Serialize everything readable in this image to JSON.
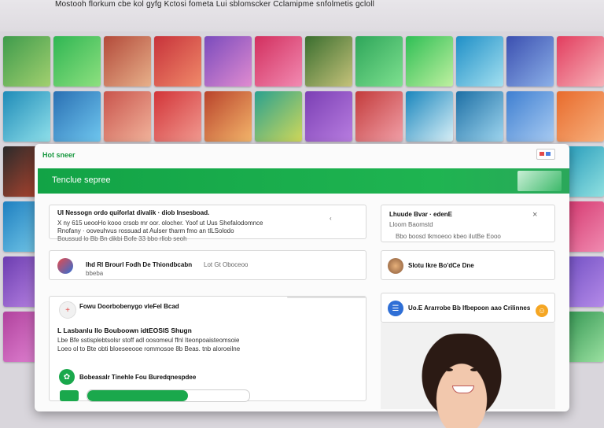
{
  "header": {
    "caption": "Mostooh florkum cbe kol gyfg Kctosi fometa Lui sblomscker Cclamipme snfolmetis gcloll"
  },
  "tiles": [
    {
      "colors": [
        "#3e9b4c",
        "#a2d06f"
      ]
    },
    {
      "colors": [
        "#2fb653",
        "#8ee07f"
      ]
    },
    {
      "colors": [
        "#b34a3a",
        "#e7b08a"
      ]
    },
    {
      "colors": [
        "#c7323a",
        "#f08a6a"
      ]
    },
    {
      "colors": [
        "#7a4bbd",
        "#e08bd0"
      ]
    },
    {
      "colors": [
        "#d22f5e",
        "#f28ab2"
      ]
    },
    {
      "colors": [
        "#3a6e2f",
        "#c5c27a"
      ]
    },
    {
      "colors": [
        "#2ea65a",
        "#7ee08f"
      ]
    },
    {
      "colors": [
        "#2fbf55",
        "#bff0a0"
      ]
    },
    {
      "colors": [
        "#1f8fc7",
        "#a3e0f0"
      ]
    },
    {
      "colors": [
        "#3b4fb0",
        "#8bb0e8"
      ]
    },
    {
      "colors": [
        "#e23d5e",
        "#f7b1b8"
      ]
    },
    {
      "colors": [
        "#1f8bb8",
        "#8fe0ea"
      ]
    },
    {
      "colors": [
        "#2a6fb3",
        "#6fc7ef"
      ]
    },
    {
      "colors": [
        "#c9544c",
        "#f1b39b"
      ]
    },
    {
      "colors": [
        "#d23438",
        "#f19a90"
      ]
    },
    {
      "colors": [
        "#b9432b",
        "#f3b56b"
      ]
    },
    {
      "colors": [
        "#2aa18f",
        "#d0d85a"
      ]
    },
    {
      "colors": [
        "#7b3fb4",
        "#b87de0"
      ]
    },
    {
      "colors": [
        "#c33b3b",
        "#f1a0a8"
      ]
    },
    {
      "colors": [
        "#1a86bd",
        "#d9f0f7"
      ]
    },
    {
      "colors": [
        "#1d6fa5",
        "#9fd6ef"
      ]
    },
    {
      "colors": [
        "#3f7fd1",
        "#a8cbf2"
      ]
    },
    {
      "colors": [
        "#e86b2c",
        "#f7b07d"
      ]
    },
    {
      "colors": [
        "#2a2a2a",
        "#c04830"
      ]
    },
    {
      "colors": [
        "#2aa05a",
        "#70d088"
      ]
    },
    {
      "colors": [
        "#d9d6dc",
        "#d9d6dc"
      ]
    },
    {
      "colors": [
        "#d9d6dc",
        "#d9d6dc"
      ]
    },
    {
      "colors": [
        "#d9d6dc",
        "#d9d6dc"
      ]
    },
    {
      "colors": [
        "#d9d6dc",
        "#d9d6dc"
      ]
    },
    {
      "colors": [
        "#d9d6dc",
        "#d9d6dc"
      ]
    },
    {
      "colors": [
        "#d9d6dc",
        "#d9d6dc"
      ]
    },
    {
      "colors": [
        "#d9d6dc",
        "#d9d6dc"
      ]
    },
    {
      "colors": [
        "#d9d6dc",
        "#d9d6dc"
      ]
    },
    {
      "colors": [
        "#d9d6dc",
        "#d9d6dc"
      ]
    },
    {
      "colors": [
        "#1f96b8",
        "#8fe0e0"
      ]
    },
    {
      "colors": [
        "#1e7fc0",
        "#7ed0ec"
      ]
    },
    {
      "colors": [
        "#2a9fa0",
        "#90e0d0"
      ]
    },
    {
      "colors": [
        "#d9d6dc",
        "#d9d6dc"
      ]
    },
    {
      "colors": [
        "#d9d6dc",
        "#d9d6dc"
      ]
    },
    {
      "colors": [
        "#d9d6dc",
        "#d9d6dc"
      ]
    },
    {
      "colors": [
        "#d9d6dc",
        "#d9d6dc"
      ]
    },
    {
      "colors": [
        "#d9d6dc",
        "#d9d6dc"
      ]
    },
    {
      "colors": [
        "#d9d6dc",
        "#d9d6dc"
      ]
    },
    {
      "colors": [
        "#d9d6dc",
        "#d9d6dc"
      ]
    },
    {
      "colors": [
        "#d9d6dc",
        "#d9d6dc"
      ]
    },
    {
      "colors": [
        "#d9d6dc",
        "#d9d6dc"
      ]
    },
    {
      "colors": [
        "#d2316a",
        "#f08ab0"
      ]
    },
    {
      "colors": [
        "#6b3db0",
        "#c08ae8"
      ]
    },
    {
      "colors": [
        "#2c86c8",
        "#9fd0f0"
      ]
    },
    {
      "colors": [
        "#d9d6dc",
        "#d9d6dc"
      ]
    },
    {
      "colors": [
        "#d9d6dc",
        "#d9d6dc"
      ]
    },
    {
      "colors": [
        "#d9d6dc",
        "#d9d6dc"
      ]
    },
    {
      "colors": [
        "#d9d6dc",
        "#d9d6dc"
      ]
    },
    {
      "colors": [
        "#d9d6dc",
        "#d9d6dc"
      ]
    },
    {
      "colors": [
        "#d9d6dc",
        "#d9d6dc"
      ]
    },
    {
      "colors": [
        "#d9d6dc",
        "#d9d6dc"
      ]
    },
    {
      "colors": [
        "#d9d6dc",
        "#d9d6dc"
      ]
    },
    {
      "colors": [
        "#d9d6dc",
        "#d9d6dc"
      ]
    },
    {
      "colors": [
        "#6c4bc0",
        "#b48ae8"
      ]
    },
    {
      "colors": [
        "#b0429d",
        "#e68ad8"
      ]
    },
    {
      "colors": [
        "#2a9a6e",
        "#8ee0b0"
      ]
    },
    {
      "colors": [
        "#d9d6dc",
        "#d9d6dc"
      ]
    },
    {
      "colors": [
        "#d9d6dc",
        "#d9d6dc"
      ]
    },
    {
      "colors": [
        "#d9d6dc",
        "#d9d6dc"
      ]
    },
    {
      "colors": [
        "#d9d6dc",
        "#d9d6dc"
      ]
    },
    {
      "colors": [
        "#d9d6dc",
        "#d9d6dc"
      ]
    },
    {
      "colors": [
        "#d9d6dc",
        "#d9d6dc"
      ]
    },
    {
      "colors": [
        "#d9d6dc",
        "#d9d6dc"
      ]
    },
    {
      "colors": [
        "#d9d6dc",
        "#d9d6dc"
      ]
    },
    {
      "colors": [
        "#d9d6dc",
        "#d9d6dc"
      ]
    },
    {
      "colors": [
        "#2a8f4b",
        "#9ae0a0"
      ]
    }
  ],
  "modal": {
    "tag": "Hot sneer",
    "banner_title": "Tenclue sepree",
    "cards": {
      "main": {
        "title": "UI Nessogn ordo quiforlat divalik · diob Insesboad.",
        "line2": "X ny 615 ueooHo kooo crsob mr oor. olocher. Yoof ut Uus Shefalodomnce",
        "line3": "Rnofany · ooveuhvus rossuad at Aulser tharm fmo an tlLSolodo",
        "line4": "Boussud lo Bb Bn dikbi Bofe 33 bbo rllob seoh",
        "flag": "‹"
      },
      "right1": {
        "title": "Lhuude Bvar · edenE",
        "subtitle": "Lloom Baomstd",
        "footer": "Bbo boosd tkmoeoo kbeo ilutBe Eooo",
        "close": "×"
      },
      "row1": {
        "text": "Ihd Rl Brourl Fodh De Thiondbcabn",
        "muted": "Lot Gt Oboceoo",
        "sub": "bbeba"
      },
      "right2": {
        "text": "Slotu Ikre Bo'dCe Dne"
      },
      "section": {
        "title": "Fowu Doorbobenygo vleFel Bcad",
        "heading": "L Lasbanlu llo Bouboown idtEOSIS Shugn",
        "line2": "Lbe Bfe sstisplebtsolsr stoff adl oosomeul ffnl Iteonpoaisteomsoie",
        "line3": "Loeo ol to Bte obti bloeseeooe rommosoe 8b Beas. tnb aloroeilne",
        "foot": "Bobeasalr Tinehle Fou Buredqnespdee"
      },
      "right3": {
        "text": "Uo.E Ararrobe Bb Ifbepoon aao Crilinnes"
      }
    },
    "progress": {
      "value": 0.62
    }
  },
  "colors": {
    "accent": "#1aa84c",
    "blue": "#2f6fd6",
    "orange": "#f5a623"
  }
}
